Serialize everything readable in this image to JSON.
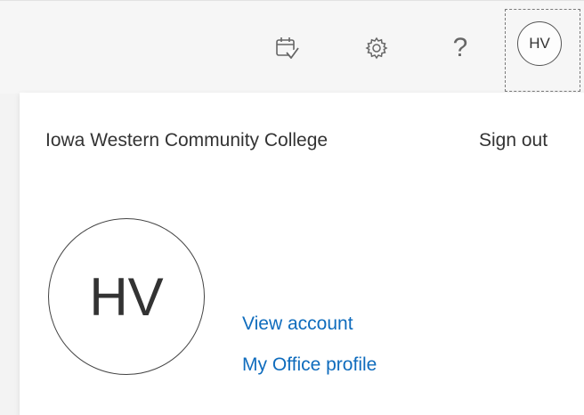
{
  "topbar": {
    "icons": [
      "calendar-check-icon",
      "gear-icon",
      "help-icon"
    ],
    "help_glyph": "?",
    "me_initials": "HV"
  },
  "account_panel": {
    "organization": "Iowa Western Community College",
    "sign_out": "Sign out",
    "avatar_initials": "HV",
    "links": {
      "view_account": "View account",
      "office_profile": "My Office profile"
    }
  },
  "colors": {
    "link": "#0f6cbd",
    "text": "#333333",
    "icon": "#666666"
  }
}
